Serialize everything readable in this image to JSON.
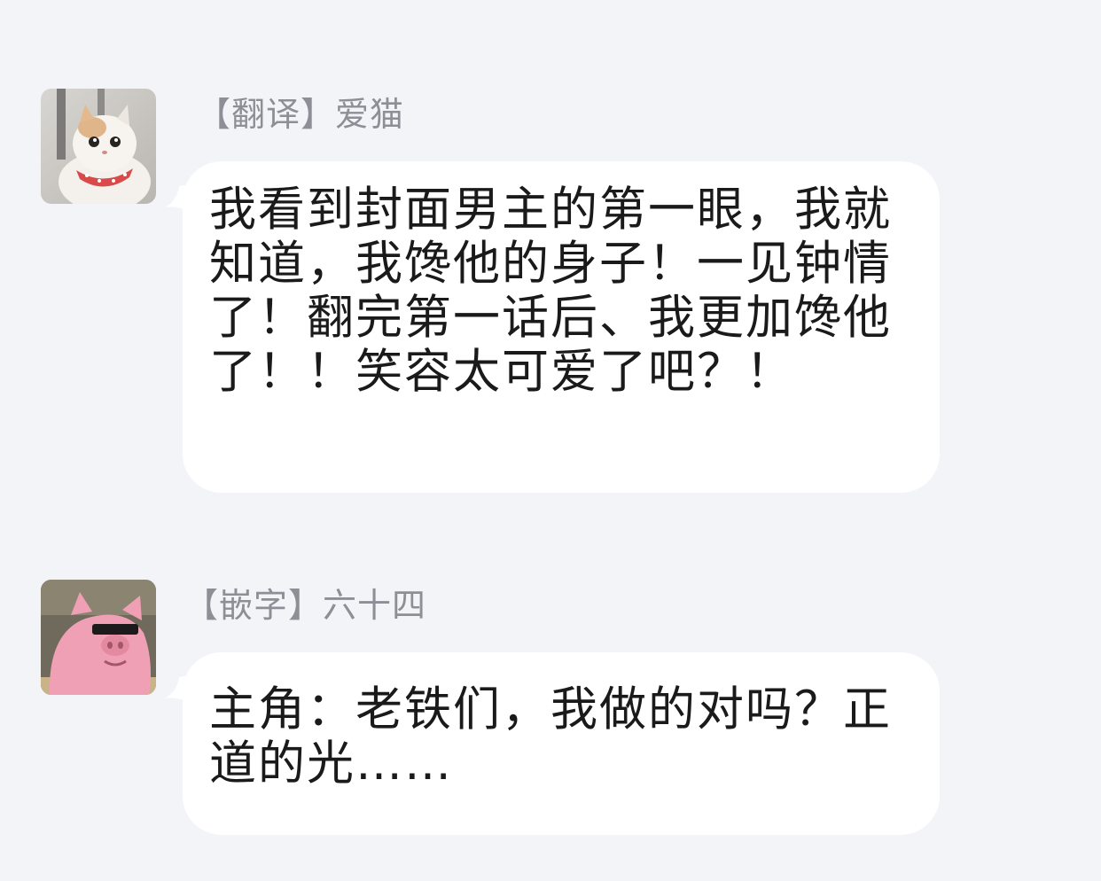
{
  "messages": [
    {
      "sender": "【翻译】爱猫",
      "avatar": "cat-avatar",
      "text": "我看到封面男主的第一眼，我就知道，我馋他的身子！一见钟情了！翻完第一话后、我更加馋他了！！笑容太可爱了吧？！"
    },
    {
      "sender": "【嵌字】六十四",
      "avatar": "pink-pig-avatar",
      "text": "主角：老铁们，我做的对吗？正道的光……"
    }
  ],
  "colors": {
    "background": "#f3f4f8",
    "bubble": "#ffffff",
    "sender_name": "#8e8f96",
    "message_text": "#1a1a1a"
  }
}
